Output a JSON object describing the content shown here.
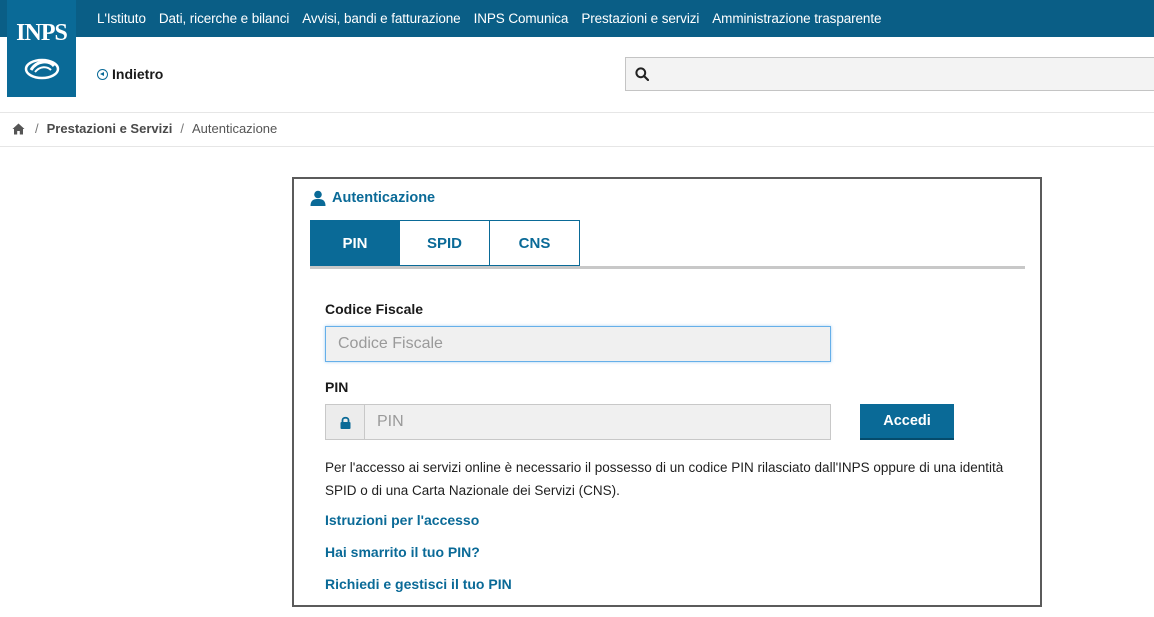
{
  "logo": {
    "text": "INPS"
  },
  "topnav": {
    "items": [
      "L'Istituto",
      "Dati, ricerche e bilanci",
      "Avvisi, bandi e fatturazione",
      "INPS Comunica",
      "Prestazioni e servizi",
      "Amministrazione trasparente"
    ]
  },
  "header": {
    "back_label": "Indietro"
  },
  "breadcrumb": {
    "items": [
      "Prestazioni e Servizi"
    ],
    "current": "Autenticazione"
  },
  "auth": {
    "title": "Autenticazione",
    "tabs": [
      {
        "label": "PIN",
        "active": true
      },
      {
        "label": "SPID",
        "active": false
      },
      {
        "label": "CNS",
        "active": false
      }
    ],
    "codice_fiscale_label": "Codice Fiscale",
    "codice_fiscale_placeholder": "Codice Fiscale",
    "pin_label": "PIN",
    "pin_placeholder": "PIN",
    "submit_label": "Accedi",
    "info_text": "Per l'accesso ai servizi online è necessario il possesso di un codice PIN rilasciato dall'INPS oppure di una identità SPID o di una Carta Nazionale dei Servizi (CNS).",
    "links": [
      "Istruzioni per l'accesso",
      "Hai smarrito il tuo PIN?",
      "Richiedi e gestisci il tuo PIN"
    ]
  },
  "colors": {
    "brand": "#0a6a97",
    "topbar": "#0a5e86"
  }
}
